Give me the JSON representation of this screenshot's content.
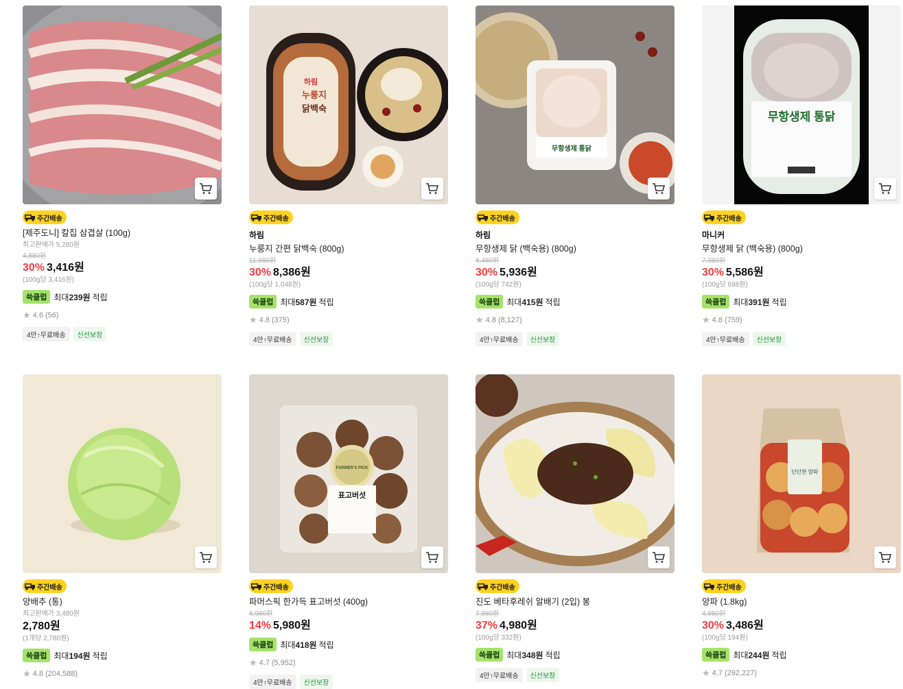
{
  "badge_label": "주간배송",
  "products": [
    {
      "brand": "",
      "name": "[제주도니] 칼집 삼겹살 (100g)",
      "max_price": "최고판매가 5,280원",
      "original_price": "4,880원",
      "discount": "30%",
      "price": "3,416원",
      "unit_price": "(100g당 3,416원)",
      "point_tag": "쓱클럽",
      "point_prefix": "최대",
      "point_amount": "239원",
      "point_suffix": "적립",
      "rating": "4.6",
      "reviews": "(56)",
      "tags": [
        "4만↑무료배송",
        "신선보장"
      ]
    },
    {
      "brand": "하림",
      "name": "누룽지 간편 닭백숙 (800g)",
      "max_price": "",
      "original_price": "11,980원",
      "discount": "30%",
      "price": "8,386원",
      "unit_price": "(100g당 1,048원)",
      "point_tag": "쓱클럽",
      "point_prefix": "최대",
      "point_amount": "587원",
      "point_suffix": "적립",
      "rating": "4.8",
      "reviews": "(375)",
      "tags": [
        "4만↑무료배송",
        "신선보장"
      ]
    },
    {
      "brand": "하림",
      "name": "무항생제 닭 (백숙용) (800g)",
      "max_price": "",
      "original_price": "8,480원",
      "discount": "30%",
      "price": "5,936원",
      "unit_price": "(100g당 742원)",
      "point_tag": "쓱클럽",
      "point_prefix": "최대",
      "point_amount": "415원",
      "point_suffix": "적립",
      "rating": "4.8",
      "reviews": "(8,127)",
      "tags": [
        "4만↑무료배송",
        "신선보장"
      ]
    },
    {
      "brand": "마니커",
      "name": "무항생제 닭 (백숙용) (800g)",
      "max_price": "",
      "original_price": "7,980원",
      "discount": "30%",
      "price": "5,586원",
      "unit_price": "(100g당 698원)",
      "point_tag": "쓱클럽",
      "point_prefix": "최대",
      "point_amount": "391원",
      "point_suffix": "적립",
      "rating": "4.8",
      "reviews": "(759)",
      "tags": [
        "4만↑무료배송",
        "신선보장"
      ]
    },
    {
      "brand": "",
      "name": "양배추 (통)",
      "max_price": "최고판매가 3,480원",
      "original_price": "",
      "discount": "",
      "price": "2,780원",
      "unit_price": "(1개당 2,780원)",
      "point_tag": "쓱클럽",
      "point_prefix": "최대",
      "point_amount": "194원",
      "point_suffix": "적립",
      "rating": "4.8",
      "reviews": "(204,588)",
      "tags": []
    },
    {
      "brand": "",
      "name": "파머스픽 한가득 표고버섯 (400g)",
      "max_price": "",
      "original_price": "6,980원",
      "discount": "14%",
      "price": "5,980원",
      "unit_price": "",
      "point_tag": "쓱클럽",
      "point_prefix": "최대",
      "point_amount": "418원",
      "point_suffix": "적립",
      "rating": "4.7",
      "reviews": "(5,952)",
      "tags": [
        "4만↑무료배송",
        "신선보장"
      ]
    },
    {
      "brand": "",
      "name": "진도 베타후레쉬 알배기 (2입) 봉",
      "max_price": "",
      "original_price": "7,980원",
      "discount": "37%",
      "price": "4,980원",
      "unit_price": "(100g당 332원)",
      "point_tag": "쓱클럽",
      "point_prefix": "최대",
      "point_amount": "348원",
      "point_suffix": "적립",
      "rating": "",
      "reviews": "",
      "tags": [
        "4만↑무료배송",
        "신선보장"
      ]
    },
    {
      "brand": "",
      "name": "양파 (1.8kg)",
      "max_price": "",
      "original_price": "4,980원",
      "discount": "30%",
      "price": "3,486원",
      "unit_price": "(100g당 194원)",
      "point_tag": "쓱클럽",
      "point_prefix": "최대",
      "point_amount": "244원",
      "point_suffix": "적립",
      "rating": "4.7",
      "reviews": "(292,227)",
      "tags": []
    }
  ],
  "image_text": {
    "harim": "하림",
    "nurungji": "누룽지",
    "dakbaeksuk": "닭백숙",
    "muhang_tongdak": "무항생제 통닭",
    "muhang_small": "무항생제 통닭",
    "farmers_pick": "FARMER'S PICK",
    "pyogo": "표고버섯",
    "onion_label": "단단한 양파"
  }
}
